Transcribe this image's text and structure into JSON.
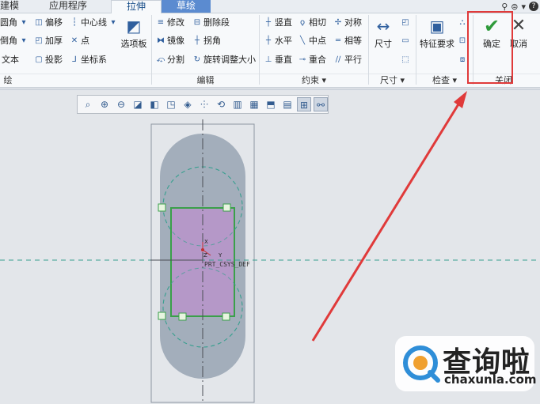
{
  "tabs": [
    "建模",
    "应用程序",
    "拉伸",
    "草绘"
  ],
  "top_icons": [
    "search-icon",
    "help-icon"
  ],
  "ribbon": {
    "col1": [
      {
        "label": "圆角",
        "icon": "fillet-icon"
      },
      {
        "label": "倒角",
        "icon": "chamfer-icon"
      },
      {
        "label": "文本",
        "icon": "text-icon"
      }
    ],
    "col2": [
      {
        "label": "偏移",
        "icon": "offset-icon"
      },
      {
        "label": "加厚",
        "icon": "thicken-icon"
      },
      {
        "label": "投影",
        "icon": "project-icon"
      }
    ],
    "col3": [
      {
        "label": "中心线",
        "icon": "centerline-icon"
      },
      {
        "label": "点",
        "icon": "point-icon"
      },
      {
        "label": "坐标系",
        "icon": "csys-icon"
      }
    ],
    "palette_label": "选项板",
    "edit_col1": [
      {
        "label": "修改",
        "icon": "modify-icon"
      },
      {
        "label": "镜像",
        "icon": "mirror-icon"
      },
      {
        "label": "分割",
        "icon": "divide-icon"
      }
    ],
    "edit_col2": [
      {
        "label": "删除段",
        "icon": "delete-segment-icon"
      },
      {
        "label": "拐角",
        "icon": "corner-icon"
      },
      {
        "label": "旋转调整大小",
        "icon": "rotate-resize-icon"
      }
    ],
    "constraint_col1": [
      {
        "label": "竖直",
        "icon": "vertical-icon"
      },
      {
        "label": "水平",
        "icon": "horizontal-icon"
      },
      {
        "label": "垂直",
        "icon": "perpendicular-icon"
      }
    ],
    "constraint_col2": [
      {
        "label": "相切",
        "icon": "tangent-icon"
      },
      {
        "label": "中点",
        "icon": "midpoint-icon"
      },
      {
        "label": "重合",
        "icon": "coincident-icon"
      }
    ],
    "constraint_col3": [
      {
        "label": "对称",
        "icon": "symmetric-icon"
      },
      {
        "label": "相等",
        "icon": "equal-icon"
      },
      {
        "label": "平行",
        "icon": "parallel-icon"
      }
    ],
    "dimension_label": "尺寸",
    "feature_req_label": "特征要求",
    "ok_label": "确定",
    "cancel_label": "取消",
    "groups": {
      "sketch": "绘",
      "edit": "编辑",
      "constraint": "约束 ▾",
      "dimension": "尺寸 ▾",
      "inspect": "检查 ▾",
      "close": "关闭"
    }
  },
  "canvas": {
    "csys_label": "PRT_CSYS_DEF",
    "axis_x": "X",
    "axis_y": "Y",
    "axis_z": "Z"
  },
  "watermark": {
    "brand_cn": "查询啦",
    "brand_en": "chaxunla.com"
  },
  "colors": {
    "highlight_box": "#e03a3a",
    "arrow": "#e03a3a",
    "sketch_fill": "#b598c8",
    "sketch_border": "#3aa04a",
    "outline_fill": "#a3aebb",
    "centerline": "#3aa090"
  }
}
